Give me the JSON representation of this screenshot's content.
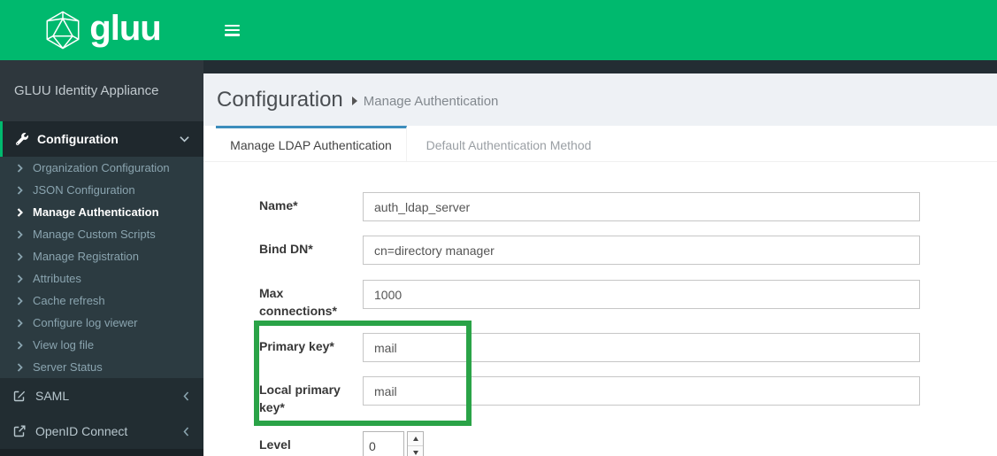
{
  "colors": {
    "brand_green": "#00b96e",
    "annotation_green": "#2aa347",
    "tab_accent_blue": "#3c8dbc"
  },
  "navbar": {
    "logo_text": "gluu"
  },
  "sidebar": {
    "title": "GLUU Identity Appliance",
    "section": {
      "label": "Configuration",
      "items": [
        {
          "label": "Organization Configuration",
          "active": false
        },
        {
          "label": "JSON Configuration",
          "active": false
        },
        {
          "label": "Manage Authentication",
          "active": true
        },
        {
          "label": "Manage Custom Scripts",
          "active": false
        },
        {
          "label": "Manage Registration",
          "active": false
        },
        {
          "label": "Attributes",
          "active": false
        },
        {
          "label": "Cache refresh",
          "active": false
        },
        {
          "label": "Configure log viewer",
          "active": false
        },
        {
          "label": "View log file",
          "active": false
        },
        {
          "label": "Server Status",
          "active": false
        }
      ]
    },
    "collapsed_sections": [
      {
        "label": "SAML",
        "icon": "edit-icon"
      },
      {
        "label": "OpenID Connect",
        "icon": "external-link-icon"
      }
    ]
  },
  "content": {
    "breadcrumb": {
      "primary": "Configuration",
      "secondary": "Manage Authentication"
    },
    "tabs": [
      {
        "label": "Manage LDAP Authentication",
        "active": true
      },
      {
        "label": "Default Authentication Method",
        "active": false
      }
    ],
    "form": {
      "fields": [
        {
          "label": "Name",
          "required": true,
          "value": "auth_ldap_server",
          "kind": "text"
        },
        {
          "label": "Bind DN",
          "required": true,
          "value": "cn=directory manager",
          "kind": "text"
        },
        {
          "label": "Max connections",
          "required": true,
          "value": "1000",
          "kind": "text"
        },
        {
          "label": "Primary key",
          "required": true,
          "value": "mail",
          "kind": "text"
        },
        {
          "label": "Local primary key",
          "required": true,
          "value": "mail",
          "kind": "text"
        },
        {
          "label": "Level",
          "required": false,
          "value": "0",
          "kind": "number"
        }
      ]
    }
  },
  "icons": {
    "logo": "gluu-icosahedron-icon",
    "menu_toggle": "hamburger-icon",
    "configuration": "wrench-icon",
    "submenu_bullet": "chevron-right-icon",
    "section_expanded": "chevron-down-icon",
    "section_collapsed": "chevron-left-icon",
    "saml": "edit-icon",
    "openid": "external-link-icon",
    "spinner": "spinner-up-down-icons"
  }
}
